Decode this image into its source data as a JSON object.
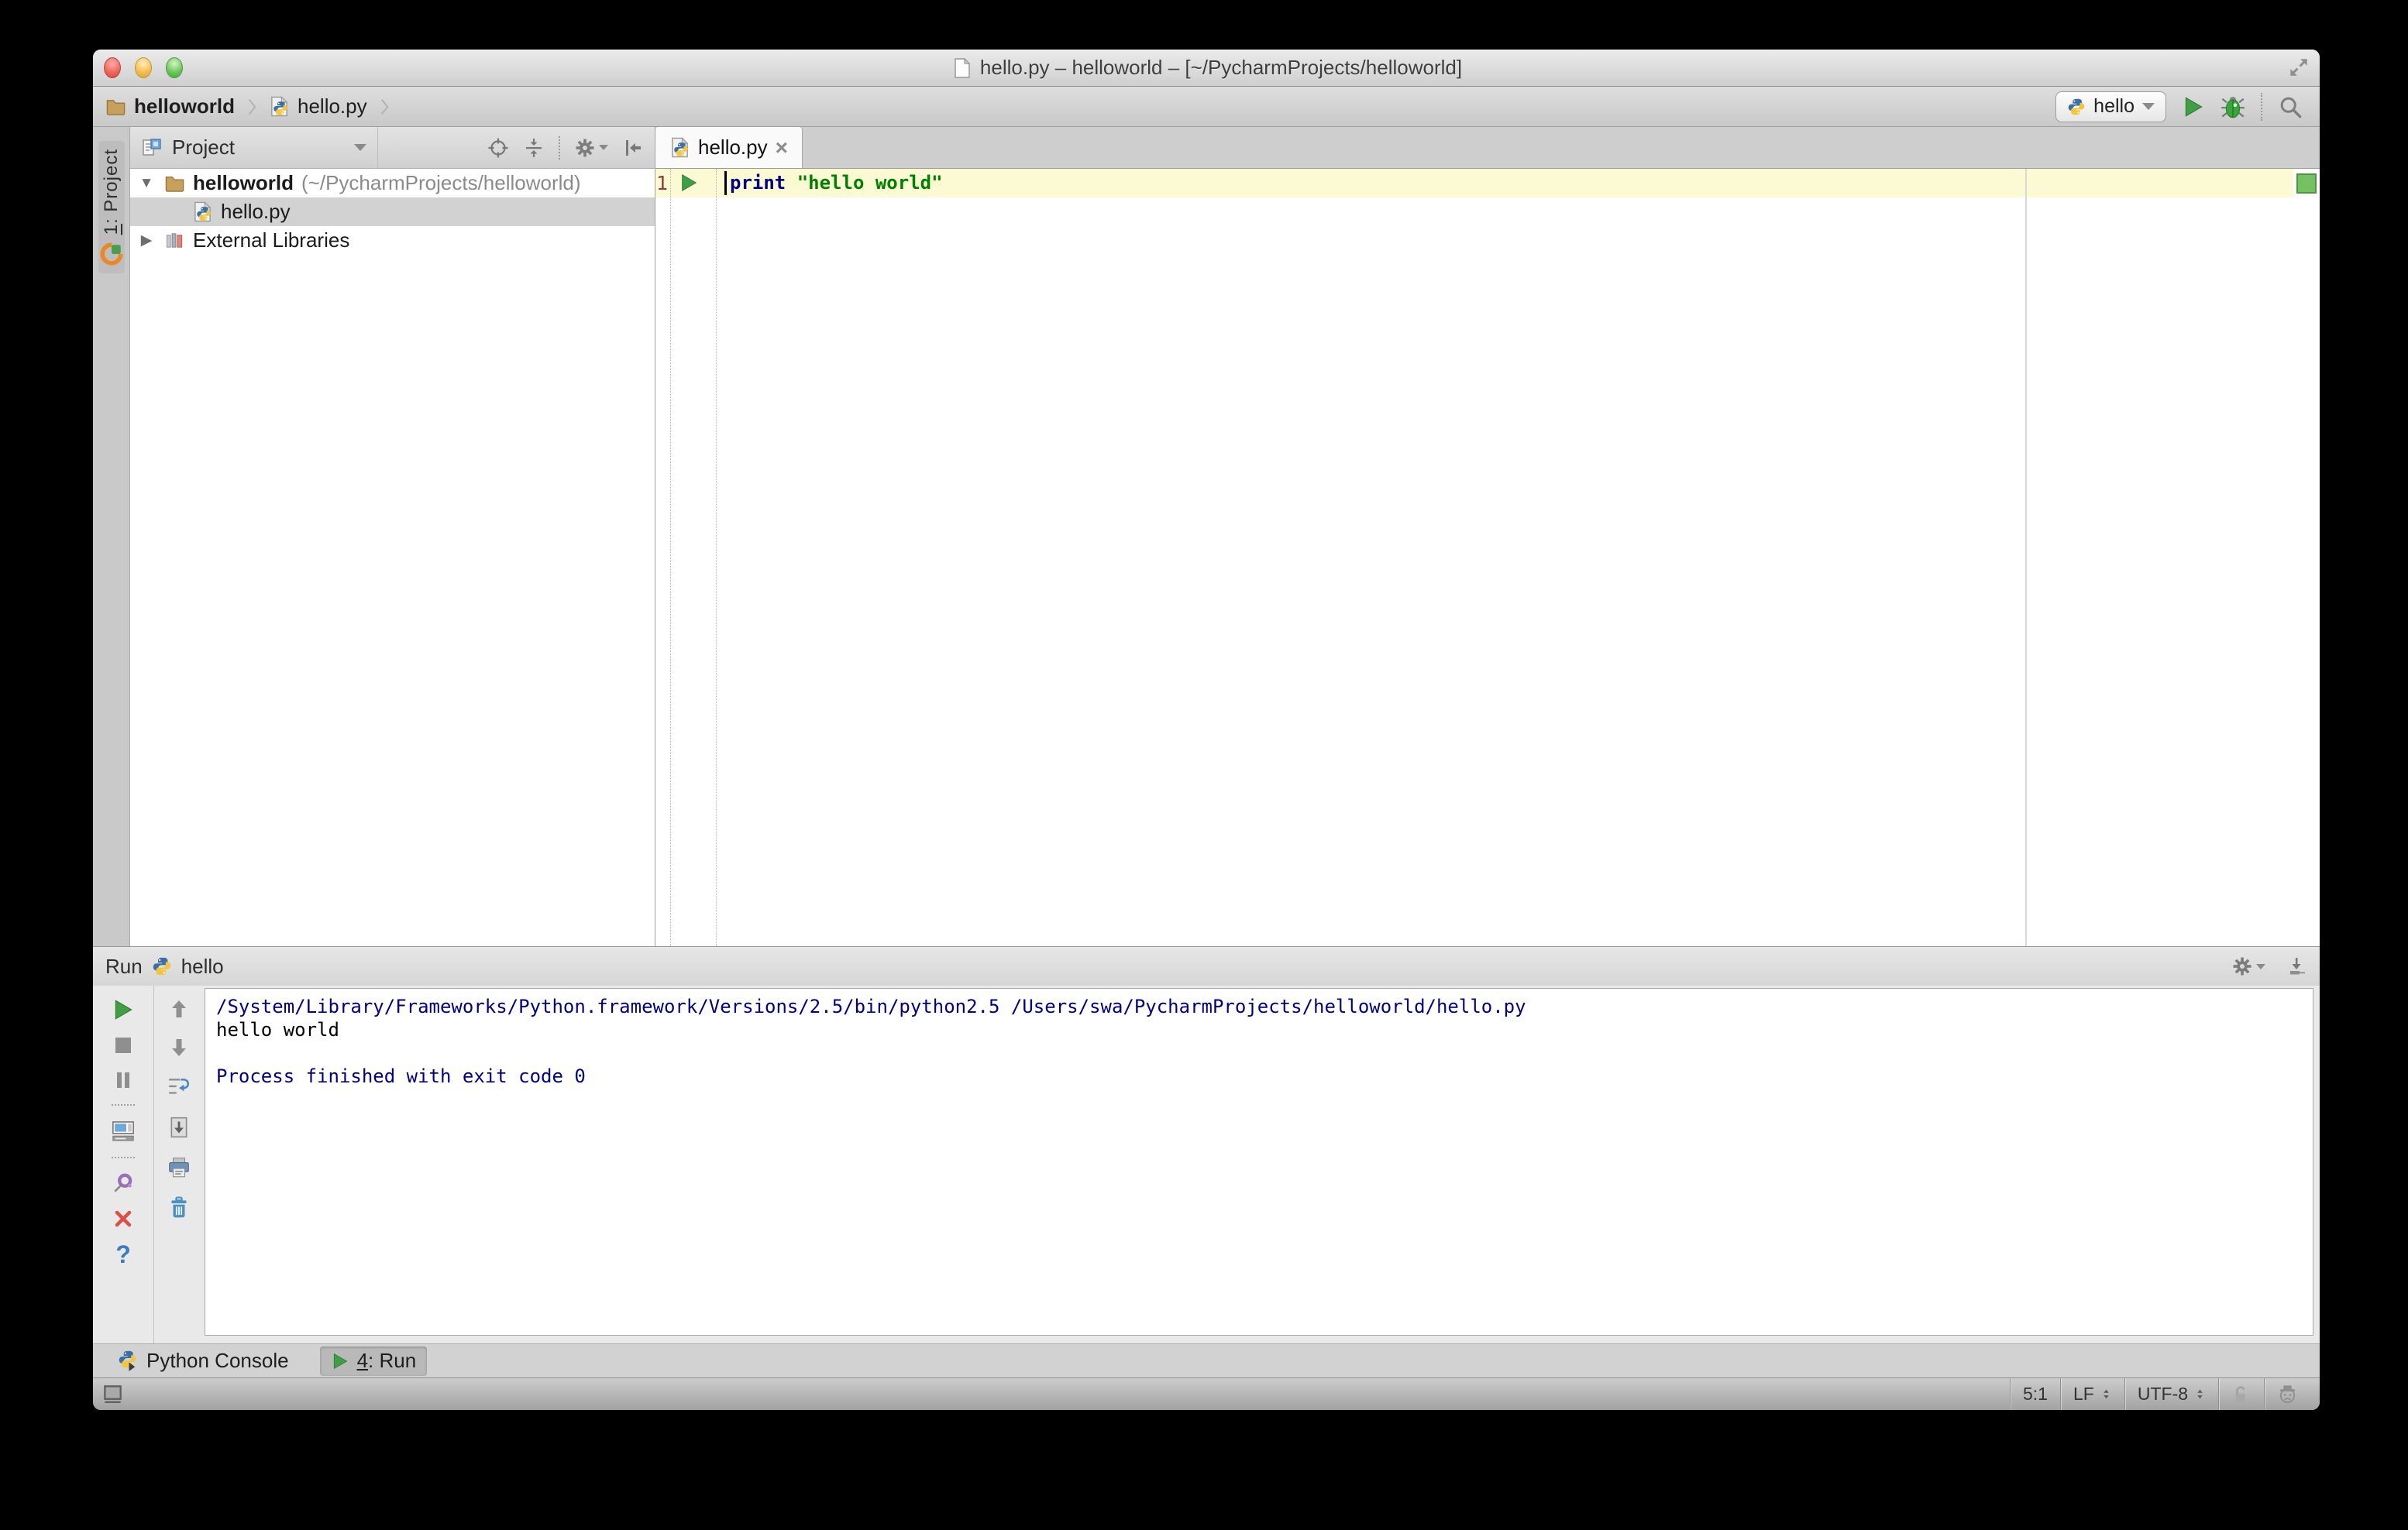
{
  "window": {
    "title": "hello.py – helloworld – [~/PycharmProjects/helloworld]"
  },
  "navbar": {
    "project_crumb": "helloworld",
    "file_crumb": "hello.py",
    "run_config": "hello"
  },
  "tool_stripe": {
    "project_shortcut": "1",
    "project_label": ": Project"
  },
  "project_panel": {
    "header": "Project",
    "tree": [
      {
        "arrow": "▼",
        "label": "helloworld",
        "path": "(~/PycharmProjects/helloworld)"
      },
      {
        "label": "hello.py"
      },
      {
        "arrow": "▶",
        "label": "External Libraries"
      }
    ]
  },
  "editor": {
    "tab_label": "hello.py",
    "tab_close": "×",
    "line_number": "1",
    "code_keyword": "print",
    "code_string": "\"hello world\""
  },
  "run_panel": {
    "title": "Run",
    "config_name": "hello",
    "help_glyph": "?",
    "console_lines": [
      "/System/Library/Frameworks/Python.framework/Versions/2.5/bin/python2.5 /Users/swa/PycharmProjects/helloworld/hello.py",
      "hello world",
      "",
      "Process finished with exit code 0"
    ]
  },
  "bottom_bar": {
    "python_console_label": "Python Console",
    "run_tab_shortcut": "4",
    "run_tab_label": ": Run"
  },
  "status_bar": {
    "caret_position": "5:1",
    "line_separator": "LF",
    "encoding": "UTF-8"
  },
  "icons": {
    "run": "green-play-triangle",
    "debug": "green-bug",
    "search_everywhere": "magnifier",
    "settings": "gear",
    "scroll_to_source": "crosshair-target",
    "collapse_all": "arrows-to-line",
    "hide_panel": "bar-left-arrow",
    "pin": "purple-pushpin",
    "close": "red-x",
    "expanded_node": "▼",
    "collapsed_node": "▶"
  },
  "colors": {
    "keyword": "#000080",
    "string": "#008000",
    "console_info": "#000080",
    "console_stdout": "#000000",
    "caret_row": "#fbfad3",
    "tree_selection": "#d2d2d2",
    "run_green": "#3f9e46",
    "line_number": "#8b3b3b",
    "inspection_ok": "#74c163"
  }
}
